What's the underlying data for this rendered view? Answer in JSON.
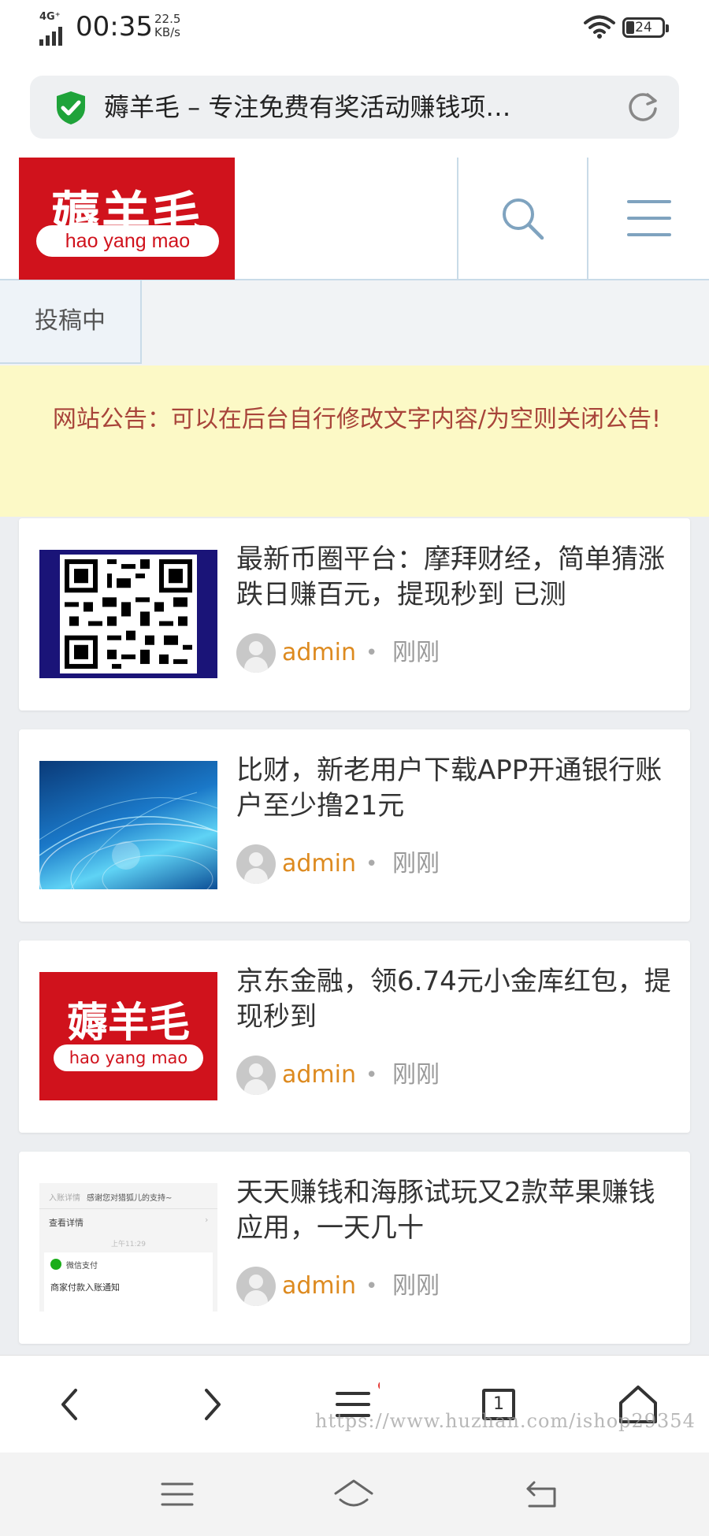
{
  "status": {
    "network": "4G⁺",
    "time": "00:35",
    "speed_value": "22.5",
    "speed_unit": "KB/s",
    "battery": "24"
  },
  "browser": {
    "page_title": "薅羊毛 – 专注免费有奖活动赚钱项…",
    "secure_icon": "shield-check-icon",
    "reload_icon": "reload-icon"
  },
  "site": {
    "logo_cn": "薅羊毛",
    "logo_pinyin": "hao yang mao",
    "search_icon": "search-icon",
    "menu_icon": "menu-icon",
    "submit_tab": "投稿中",
    "notice": "网站公告：可以在后台自行修改文字内容/为空则关闭公告!"
  },
  "posts": [
    {
      "title": "最新币圈平台：摩拜财经，简单猜涨跌日赚百元，提现秒到 已测",
      "author": "admin",
      "separator": "•",
      "time": "刚刚",
      "thumb": "qr-code"
    },
    {
      "title": "比财，新老用户下载APP开通银行账户至少撸21元",
      "author": "admin",
      "separator": "•",
      "time": "刚刚",
      "thumb": "globe"
    },
    {
      "title": "京东金融，领6.74元小金库红包，提现秒到",
      "author": "admin",
      "separator": "•",
      "time": "刚刚",
      "thumb": "logo",
      "thumb_cn": "薅羊毛",
      "thumb_pinyin": "hao yang mao"
    },
    {
      "title": "天天赚钱和海豚试玩又2款苹果赚钱应用，一天几十",
      "author": "admin",
      "separator": "•",
      "time": "刚刚",
      "thumb": "screenshot",
      "thumb_lines": [
        "入账详情",
        "感谢您对猎狐儿的支持~",
        "查看详情",
        "上午11:29",
        "微信支付",
        "商家付款入账通知"
      ]
    }
  ],
  "toolbar": {
    "back_icon": "chevron-left-icon",
    "forward_icon": "chevron-right-icon",
    "menu_icon": "menu-icon",
    "tabs_count": "1",
    "home_icon": "home-icon",
    "watermark": "https://www.huzhan.com/ishop29354"
  },
  "system_nav": {
    "menu_icon": "menu-icon",
    "home_icon": "home-icon",
    "back_icon": "back-icon"
  },
  "colors": {
    "logo_red": "#d0121c",
    "author_orange": "#dd8a1f",
    "notice_bg": "#fcf9c6",
    "notice_text": "#a8443a",
    "accent_blue": "#7fa3bf",
    "secure_green": "#1fa33a"
  }
}
